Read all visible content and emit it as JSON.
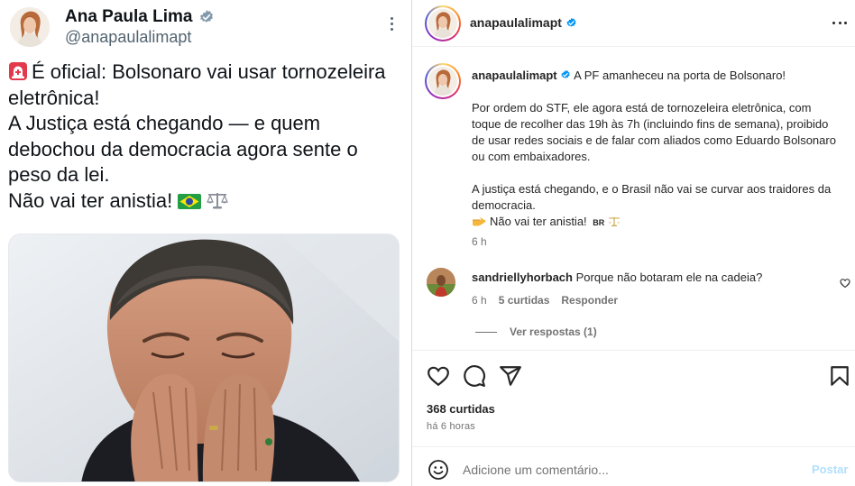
{
  "tweet": {
    "author_name": "Ana Paula Lima",
    "handle": "@anapaulalimapt",
    "text_lines": [
      "É oficial: Bolsonaro vai usar tornozeleira",
      "eletrônica!",
      "A Justiça está chegando — e quem",
      "debochou da democracia agora sente o",
      "peso da lei.",
      "Não vai ter anistia!"
    ],
    "icons": [
      "siren-icon",
      "verified-badge-icon",
      "brazil-flag-icon",
      "scales-icon",
      "more-options-icon"
    ],
    "colors": {
      "text": "#0f1419",
      "secondary": "#536471",
      "verified": "#829aab"
    }
  },
  "instagram": {
    "header": {
      "username": "anapaulalimapt"
    },
    "caption": {
      "username": "anapaulalimapt",
      "first_line": "A PF amanheceu na porta de Bolsonaro!",
      "paragraph_1": "Por ordem do STF, ele agora está de tornozeleira eletrônica, com toque de recolher das 19h às 7h (incluindo fins de semana), proibido de usar redes sociais e de falar com aliados como Eduardo Bolsonaro ou com embaixadores.",
      "paragraph_2": "A justiça está chegando, e o Brasil não vai se curvar aos traidores da democracia.",
      "last_line": "Não vai ter anistia!",
      "flag_text": "BR",
      "time": "6 h"
    },
    "comment": {
      "username": "sandriellyhorbach",
      "text": "Porque não botaram ele na cadeia?",
      "time": "6 h",
      "likes": "5 curtidas",
      "reply_label": "Responder",
      "view_replies": "Ver respostas (1)"
    },
    "likes": "368 curtidas",
    "posted_ago": "há 6 horas",
    "comment_placeholder": "Adicione um comentário...",
    "post_button": "Postar",
    "icons": [
      "heart-icon",
      "comment-icon",
      "share-icon",
      "bookmark-icon",
      "emoji-icon",
      "verified-badge-icon",
      "more-options-icon"
    ],
    "colors": {
      "verified": "#0095f6",
      "text": "#262626",
      "muted": "#737373",
      "post_button": "#b2dffc"
    }
  }
}
